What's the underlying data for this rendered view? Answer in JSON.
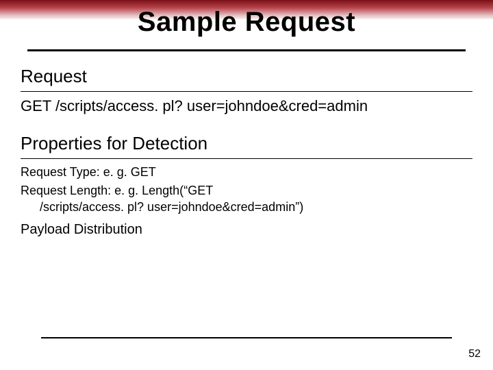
{
  "title": "Sample Request",
  "section1": {
    "heading": "Request",
    "line": "GET /scripts/access. pl? user=johndoe&cred=admin"
  },
  "section2": {
    "heading": "Properties for Detection",
    "items": {
      "reqType": "Request Type: e. g. GET",
      "reqLenPrefix": "Request Length: e. g. Length(",
      "reqLenOpenQuote": "“",
      "reqLenInner": "GET /scripts/access. pl? user=johndoe&cred=admin",
      "reqLenClose": "”)",
      "payload": "Payload Distribution"
    }
  },
  "pageNumber": "52"
}
